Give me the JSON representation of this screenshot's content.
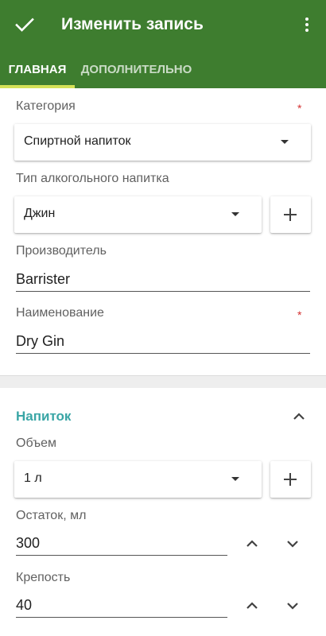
{
  "appbar": {
    "title": "Изменить запись",
    "confirm_icon": "check-icon",
    "menu_icon": "more-vert-icon",
    "color": "#3e7d2f"
  },
  "tabs": [
    {
      "label": "ГЛАВНАЯ",
      "selected": true
    },
    {
      "label": "ДОПОЛНИТЕЛЬНО",
      "selected": false
    }
  ],
  "form": {
    "category": {
      "label": "Категория",
      "required_mark": "*",
      "value": "Спиртной напиток"
    },
    "alcohol_type": {
      "label": "Тип алкогольного напитка",
      "value": "Джин"
    },
    "producer": {
      "label": "Производитель",
      "value": "Barrister"
    },
    "name": {
      "label": "Наименование",
      "required_mark": "*",
      "value": "Dry Gin"
    }
  },
  "drink_section": {
    "title": "Напиток",
    "collapse_icon": "chevron-up-icon",
    "volume": {
      "label": "Объем",
      "value": "1 л"
    },
    "remainder": {
      "label": "Остаток, мл",
      "value": "300"
    },
    "strength": {
      "label": "Крепость",
      "value": "40"
    }
  },
  "colors": {
    "accent": "#3aa6a6",
    "tab_indicator": "#d4e157",
    "required": "#d32f2f"
  }
}
